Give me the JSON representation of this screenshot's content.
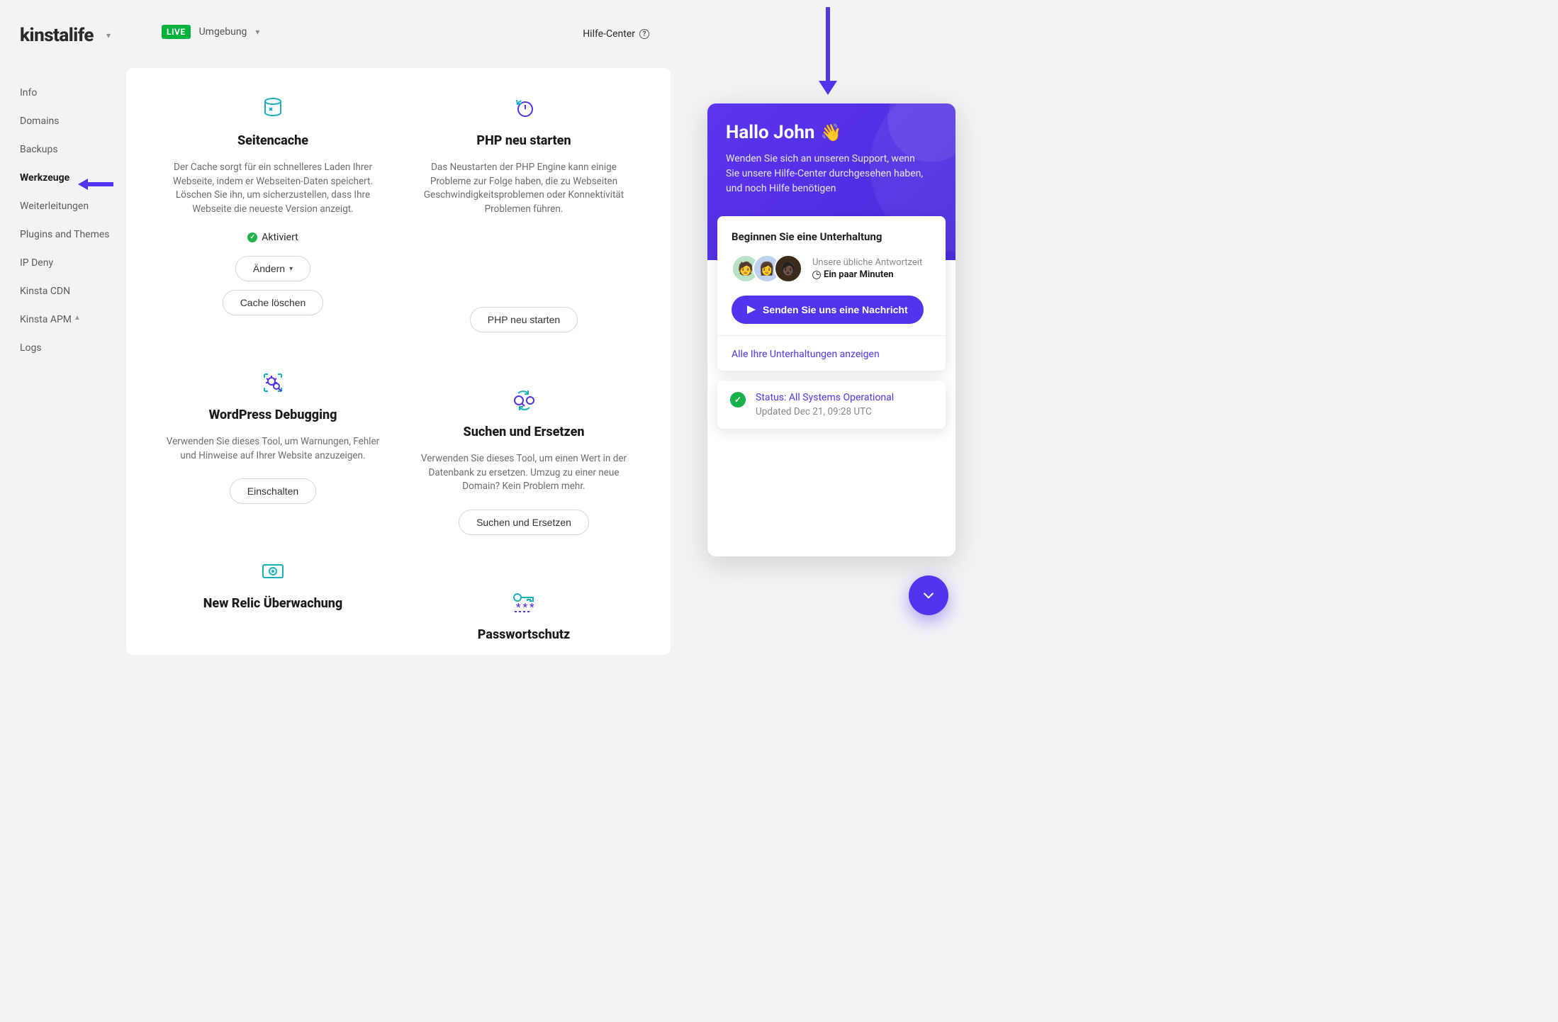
{
  "logo": "kinstalife",
  "topbar": {
    "live_badge": "LIVE",
    "env_label": "Umgebung"
  },
  "help_center_label": "Hilfe-Center",
  "sidebar": {
    "items": [
      "Info",
      "Domains",
      "Backups",
      "Werkzeuge",
      "Weiterleitungen",
      "Plugins and Themes",
      "IP Deny",
      "Kinsta CDN",
      "Kinsta APM",
      "Logs"
    ],
    "active_index": 3
  },
  "tools": {
    "cache": {
      "title": "Seitencache",
      "desc": "Der Cache sorgt für ein schnelleres Laden Ihrer Webseite, indem er Webseiten-Daten speichert. Löschen Sie ihn, um sicherzustellen, dass Ihre Webseite die neueste Version anzeigt.",
      "status": "Aktiviert",
      "change_btn": "Ändern",
      "clear_btn": "Cache löschen"
    },
    "php": {
      "title": "PHP neu starten",
      "desc": "Das Neustarten der PHP Engine kann einige Probleme zur Folge haben, die zu Webseiten Geschwindigkeitsproblemen oder Konnektivität Problemen führen.",
      "btn": "PHP neu starten"
    },
    "debug": {
      "title": "WordPress Debugging",
      "desc": "Verwenden Sie dieses Tool, um Warnungen, Fehler und Hinweise auf Ihrer Website anzuzeigen.",
      "btn": "Einschalten"
    },
    "search": {
      "title": "Suchen und Ersetzen",
      "desc": "Verwenden Sie dieses Tool, um einen Wert in der Datenbank zu ersetzen. Umzug zu einer neue Domain? Kein Problem mehr.",
      "btn": "Suchen und Ersetzen"
    },
    "newrelic": {
      "title": "New Relic Überwachung"
    },
    "password": {
      "title": "Passwortschutz"
    }
  },
  "messenger": {
    "hello": "Hallo John",
    "subtext": "Wenden Sie sich an unseren Support, wenn Sie unsere Hilfe-Center durchgesehen haben, und noch Hilfe benötigen",
    "convo_title": "Beginnen Sie eine Unterhaltung",
    "resp_label": "Unsere übliche Antwortzeit",
    "resp_value": "Ein paar Minuten",
    "send_btn": "Senden Sie uns eine Nachricht",
    "see_all": "Alle Ihre Unterhaltungen anzeigen",
    "status_label": "Status: All Systems Operational",
    "status_updated": "Updated Dec 21, 09:28 UTC"
  }
}
